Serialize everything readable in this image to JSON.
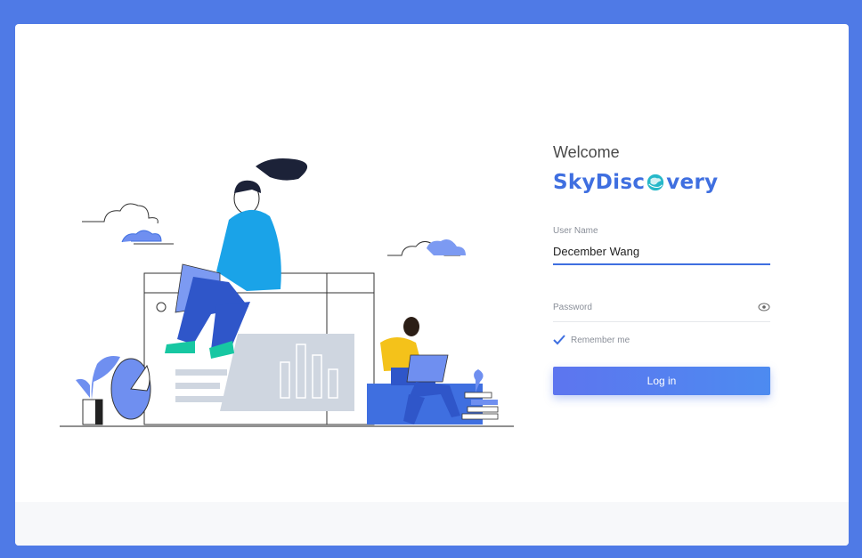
{
  "login": {
    "welcome": "Welcome",
    "brand_prefix": "SkyDisc",
    "brand_suffix": "very",
    "username_label": "User Name",
    "username_value": "December Wang",
    "password_placeholder": "Password",
    "remember_label": "Remember me",
    "login_button": "Log in"
  },
  "colors": {
    "background": "#4f7ae6",
    "brand": "#3f6fe0",
    "button_start": "#5d75ef",
    "button_end": "#4d8bf0"
  },
  "icons": {
    "password_visibility": "eye-icon",
    "remember": "check-icon",
    "brand_logo_o": "globe-icon"
  }
}
